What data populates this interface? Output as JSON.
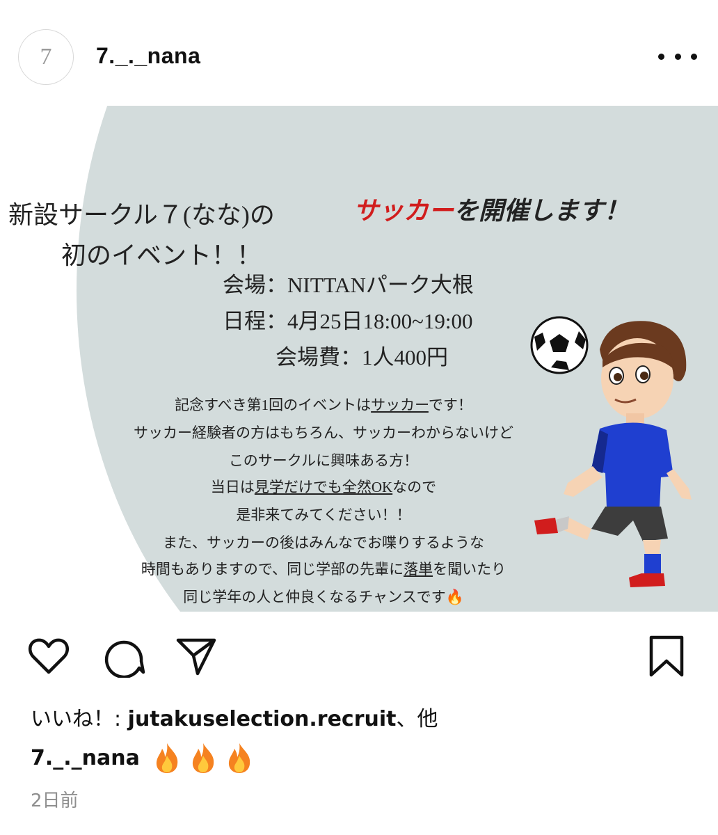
{
  "header": {
    "avatar_text": "7",
    "username": "7._._nana"
  },
  "post_image": {
    "title_line1": "新設サークル７(なな)の",
    "title_line2": "初のイベント！！",
    "headline_red": "サッカー",
    "headline_rest": "を開催します！",
    "venue": "会場：NITTANパーク大根",
    "schedule": "日程：4月25日18:00~19:00",
    "fee": "会場費：1人400円",
    "body": {
      "l1_a": "記念すべき第1回のイベントは",
      "l1_u": "サッカー",
      "l1_b": "です！",
      "l2": "サッカー経験者の方はもちろん、サッカーわからないけど",
      "l3": "このサークルに興味ある方！",
      "l4_a": "当日は",
      "l4_u": "見学だけでも全然OK",
      "l4_b": "なので",
      "l5": "是非来てみてください！！",
      "l6": "また、サッカーの後はみんなでお喋りするような",
      "l7_a": "時間もありますので、同じ学部の先輩に",
      "l7_u": "落単",
      "l7_b": "を聞いたり",
      "l8": "同じ学年の人と仲良くなるチャンスです🔥"
    },
    "colors": {
      "circle": "#d3dcdc",
      "accent_red": "#d11d1d",
      "shirt": "#1f3fd0"
    }
  },
  "actions": {
    "icons": [
      "heart-icon",
      "comment-icon",
      "share-icon",
      "bookmark-icon"
    ]
  },
  "likes": {
    "prefix": "いいね！: ",
    "user": "jutakuselection.recruit",
    "suffix": "、他"
  },
  "caption": {
    "username": "7._._nana",
    "emoji": "🔥🔥🔥"
  },
  "timestamp": "2日前"
}
